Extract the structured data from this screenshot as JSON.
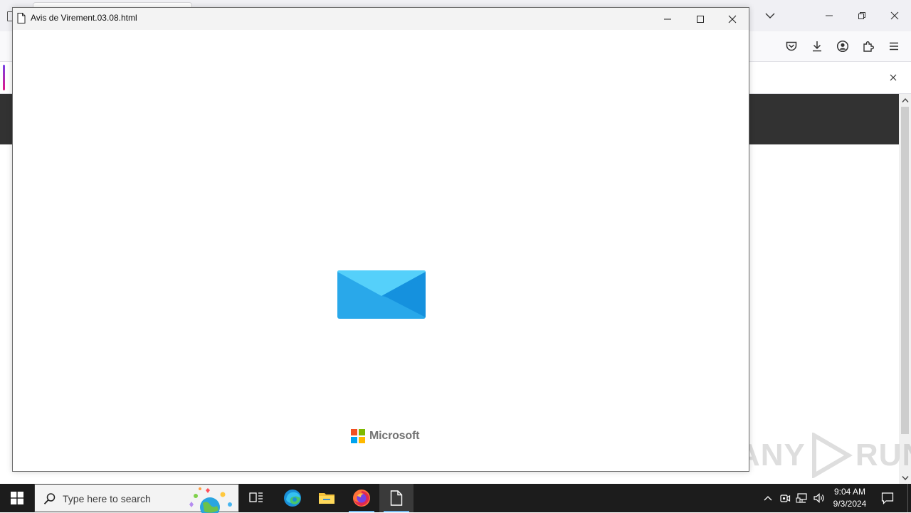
{
  "popup": {
    "title": "Avis de Virement.03.08.html",
    "brand_name": "Microsoft",
    "brand_colors": [
      "#f25022",
      "#7fba00",
      "#00a4ef",
      "#ffb900"
    ],
    "envelope_colors": {
      "body": "#29a8ea",
      "flap": "#55d0fa",
      "right_fold": "#1591de"
    },
    "icons": {
      "file": "file-icon",
      "minimize": "minimize-icon",
      "maximize": "maximize-icon",
      "close": "close-icon"
    }
  },
  "browser": {
    "toolbar_icons": [
      "pocket-icon",
      "download-icon",
      "account-icon",
      "extensions-icon",
      "menu-icon"
    ],
    "accent_colors": [
      "#7542e5",
      "#e31587"
    ]
  },
  "watermark": {
    "text_left": "ANY",
    "text_right": "RUN"
  },
  "taskbar": {
    "search_placeholder": "Type here to search",
    "apps": [
      "task-view-icon",
      "edge-icon",
      "file-explorer-icon",
      "firefox-icon",
      "file-document-icon"
    ],
    "tray_icons": [
      "chevron-up-icon",
      "meet-now-icon",
      "network-icon",
      "volume-icon"
    ],
    "clock_time": "9:04 AM",
    "clock_date": "9/3/2024"
  }
}
